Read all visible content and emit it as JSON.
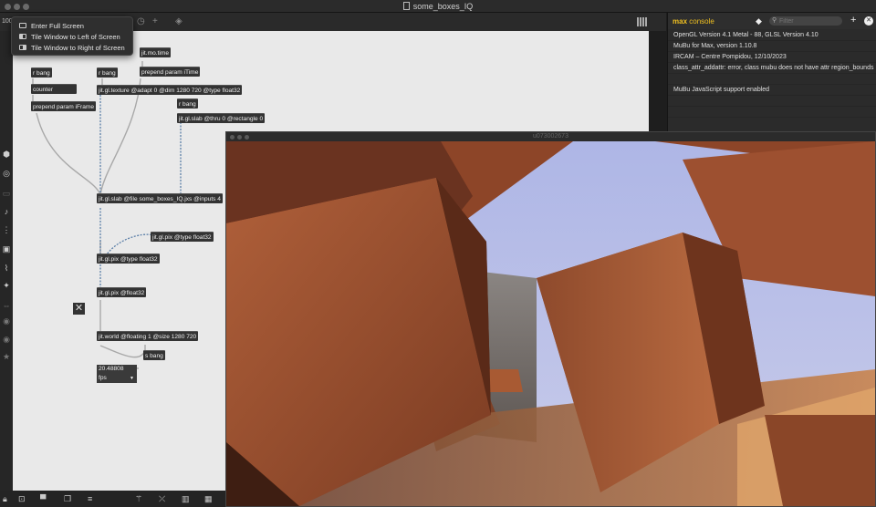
{
  "window": {
    "title": "some_boxes_IQ"
  },
  "toolbar": {
    "zoom": "100"
  },
  "menu": {
    "items": [
      {
        "label": "Enter Full Screen",
        "icon": "fullscreen-icon"
      },
      {
        "label": "Tile Window to Left of Screen",
        "icon": "tile-left-icon"
      },
      {
        "label": "Tile Window to Right of Screen",
        "icon": "tile-right-icon"
      }
    ]
  },
  "objects": {
    "rbang1": "r bang",
    "rbang2": "r bang",
    "jitmotime": "jit.mo.time",
    "counter": "counter",
    "prepend_itime": "prepend param iTime",
    "texture": "jit.gl.texture @adapt 0 @dim 1280 720 @type float32",
    "prepend_iframe": "prepend param iFrame",
    "rbang3": "r bang",
    "slab_thru": "jit.gl.slab @thru 0 @rectangle 0",
    "slab_file": "jit.gl.slab @file some_boxes_IQ.jxs @inputs 4",
    "pix1": "jit.gl.pix @type float32",
    "pix2": "jit.gl.pix @type float32",
    "pix3": "jit.gl.pix @float32",
    "world": "jit.world @floating 1 @size 1280 720",
    "sbang": "s bang"
  },
  "fps": {
    "value": "20.48808",
    "unit": "fps"
  },
  "console": {
    "title_a": "max",
    "title_b": "console",
    "filter_placeholder": "Filter",
    "lines": [
      "OpenGL Version 4.1 Metal - 88, GLSL Version 4.10",
      "MuBu for Max, version 1.10.8",
      "   IRCAM – Centre Pompidou, 12/10/2023",
      "class_attr_addattr: error, class mubu does not have attr region_bounds",
      "",
      "MuBu JavaScript support enabled",
      "",
      ""
    ]
  },
  "render": {
    "title": "u073002673"
  },
  "colors": {
    "accent": "#f0c020",
    "canvas": "#e9e9e9",
    "object": "#333333",
    "sky": "#b7bde6",
    "wood": "#a5512d"
  }
}
